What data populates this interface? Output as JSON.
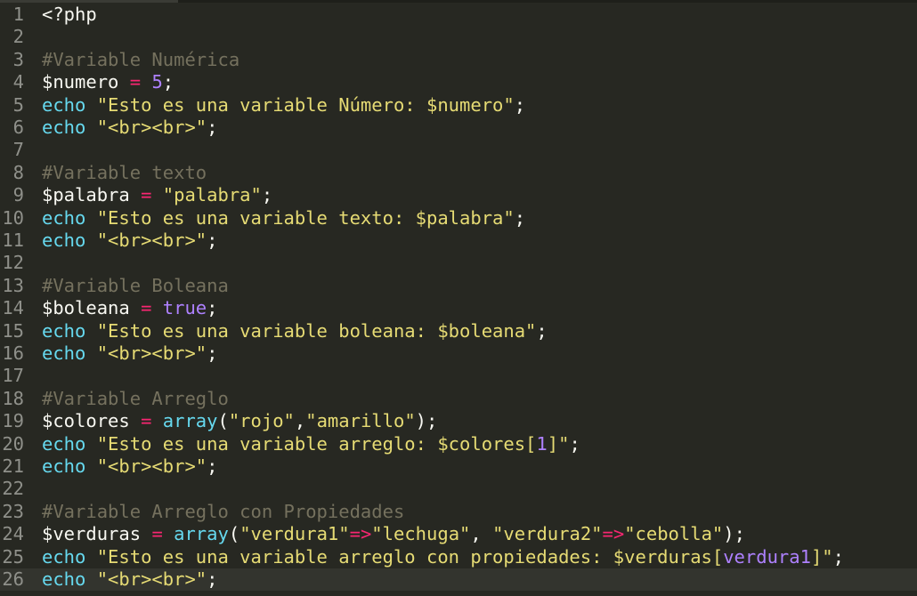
{
  "editor": {
    "current_line": 26,
    "lines": [
      {
        "n": "1",
        "tokens": [
          {
            "t": "<?php",
            "c": "punc"
          }
        ]
      },
      {
        "n": "2",
        "tokens": []
      },
      {
        "n": "3",
        "tokens": [
          {
            "t": "#Variable Numérica",
            "c": "comment"
          }
        ]
      },
      {
        "n": "4",
        "tokens": [
          {
            "t": "$numero",
            "c": "var"
          },
          {
            "t": " ",
            "c": "punc"
          },
          {
            "t": "=",
            "c": "op"
          },
          {
            "t": " ",
            "c": "punc"
          },
          {
            "t": "5",
            "c": "num"
          },
          {
            "t": ";",
            "c": "punc"
          }
        ]
      },
      {
        "n": "5",
        "tokens": [
          {
            "t": "echo",
            "c": "echo"
          },
          {
            "t": " ",
            "c": "punc"
          },
          {
            "t": "\"Esto es una variable Número: $numero\"",
            "c": "str"
          },
          {
            "t": ";",
            "c": "punc"
          }
        ]
      },
      {
        "n": "6",
        "tokens": [
          {
            "t": "echo",
            "c": "echo"
          },
          {
            "t": " ",
            "c": "punc"
          },
          {
            "t": "\"<br><br>\"",
            "c": "str"
          },
          {
            "t": ";",
            "c": "punc"
          }
        ]
      },
      {
        "n": "7",
        "tokens": []
      },
      {
        "n": "8",
        "tokens": [
          {
            "t": "#Variable texto",
            "c": "comment"
          }
        ]
      },
      {
        "n": "9",
        "tokens": [
          {
            "t": "$palabra",
            "c": "var"
          },
          {
            "t": " ",
            "c": "punc"
          },
          {
            "t": "=",
            "c": "op"
          },
          {
            "t": " ",
            "c": "punc"
          },
          {
            "t": "\"palabra\"",
            "c": "str"
          },
          {
            "t": ";",
            "c": "punc"
          }
        ]
      },
      {
        "n": "10",
        "tokens": [
          {
            "t": "echo",
            "c": "echo"
          },
          {
            "t": " ",
            "c": "punc"
          },
          {
            "t": "\"Esto es una variable texto: $palabra\"",
            "c": "str"
          },
          {
            "t": ";",
            "c": "punc"
          }
        ]
      },
      {
        "n": "11",
        "tokens": [
          {
            "t": "echo",
            "c": "echo"
          },
          {
            "t": " ",
            "c": "punc"
          },
          {
            "t": "\"<br><br>\"",
            "c": "str"
          },
          {
            "t": ";",
            "c": "punc"
          }
        ]
      },
      {
        "n": "12",
        "tokens": []
      },
      {
        "n": "13",
        "tokens": [
          {
            "t": "#Variable Boleana",
            "c": "comment"
          }
        ]
      },
      {
        "n": "14",
        "tokens": [
          {
            "t": "$boleana",
            "c": "var"
          },
          {
            "t": " ",
            "c": "punc"
          },
          {
            "t": "=",
            "c": "op"
          },
          {
            "t": " ",
            "c": "punc"
          },
          {
            "t": "true",
            "c": "kw"
          },
          {
            "t": ";",
            "c": "punc"
          }
        ]
      },
      {
        "n": "15",
        "tokens": [
          {
            "t": "echo",
            "c": "echo"
          },
          {
            "t": " ",
            "c": "punc"
          },
          {
            "t": "\"Esto es una variable boleana: $boleana\"",
            "c": "str"
          },
          {
            "t": ";",
            "c": "punc"
          }
        ]
      },
      {
        "n": "16",
        "tokens": [
          {
            "t": "echo",
            "c": "echo"
          },
          {
            "t": " ",
            "c": "punc"
          },
          {
            "t": "\"<br><br>\"",
            "c": "str"
          },
          {
            "t": ";",
            "c": "punc"
          }
        ]
      },
      {
        "n": "17",
        "tokens": []
      },
      {
        "n": "18",
        "tokens": [
          {
            "t": "#Variable Arreglo",
            "c": "comment"
          }
        ]
      },
      {
        "n": "19",
        "tokens": [
          {
            "t": "$colores",
            "c": "var"
          },
          {
            "t": " ",
            "c": "punc"
          },
          {
            "t": "=",
            "c": "op"
          },
          {
            "t": " ",
            "c": "punc"
          },
          {
            "t": "array",
            "c": "fn"
          },
          {
            "t": "(",
            "c": "punc"
          },
          {
            "t": "\"rojo\"",
            "c": "str"
          },
          {
            "t": ",",
            "c": "punc"
          },
          {
            "t": "\"amarillo\"",
            "c": "str"
          },
          {
            "t": ");",
            "c": "punc"
          }
        ]
      },
      {
        "n": "20",
        "tokens": [
          {
            "t": "echo",
            "c": "echo"
          },
          {
            "t": " ",
            "c": "punc"
          },
          {
            "t": "\"Esto es una variable arreglo: $colores[",
            "c": "str"
          },
          {
            "t": "1",
            "c": "num"
          },
          {
            "t": "]\"",
            "c": "str"
          },
          {
            "t": ";",
            "c": "punc"
          }
        ]
      },
      {
        "n": "21",
        "tokens": [
          {
            "t": "echo",
            "c": "echo"
          },
          {
            "t": " ",
            "c": "punc"
          },
          {
            "t": "\"<br><br>\"",
            "c": "str"
          },
          {
            "t": ";",
            "c": "punc"
          }
        ]
      },
      {
        "n": "22",
        "tokens": []
      },
      {
        "n": "23",
        "tokens": [
          {
            "t": "#Variable Arreglo con Propiedades",
            "c": "comment"
          }
        ]
      },
      {
        "n": "24",
        "tokens": [
          {
            "t": "$verduras",
            "c": "var"
          },
          {
            "t": " ",
            "c": "punc"
          },
          {
            "t": "=",
            "c": "op"
          },
          {
            "t": " ",
            "c": "punc"
          },
          {
            "t": "array",
            "c": "fn"
          },
          {
            "t": "(",
            "c": "punc"
          },
          {
            "t": "\"verdura1\"",
            "c": "str"
          },
          {
            "t": "=>",
            "c": "op"
          },
          {
            "t": "\"lechuga\"",
            "c": "str"
          },
          {
            "t": ", ",
            "c": "punc"
          },
          {
            "t": "\"verdura2\"",
            "c": "str"
          },
          {
            "t": "=>",
            "c": "op"
          },
          {
            "t": "\"cebolla\"",
            "c": "str"
          },
          {
            "t": ");",
            "c": "punc"
          }
        ]
      },
      {
        "n": "25",
        "tokens": [
          {
            "t": "echo",
            "c": "echo"
          },
          {
            "t": " ",
            "c": "punc"
          },
          {
            "t": "\"Esto es una variable arreglo con propiedades: $verduras[",
            "c": "str"
          },
          {
            "t": "verdura1",
            "c": "prop"
          },
          {
            "t": "]\"",
            "c": "str"
          },
          {
            "t": ";",
            "c": "punc"
          }
        ]
      },
      {
        "n": "26",
        "tokens": [
          {
            "t": "echo",
            "c": "echo"
          },
          {
            "t": " ",
            "c": "punc"
          },
          {
            "t": "\"<br><br>\"",
            "c": "str"
          },
          {
            "t": ";",
            "c": "punc"
          }
        ]
      }
    ]
  },
  "colors": {
    "background": "#272822",
    "line_number": "#8f908a",
    "comment": "#75715e",
    "string": "#e6db74",
    "keyword_echo": "#66d9ef",
    "operator": "#f92672",
    "number": "#ae81ff",
    "text": "#f8f8f2"
  }
}
